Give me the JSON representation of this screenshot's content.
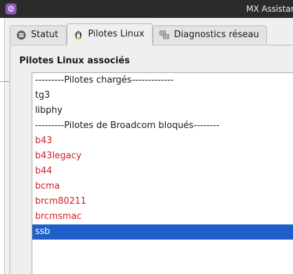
{
  "window": {
    "title": "MX Assistant",
    "icon": "gear-icon"
  },
  "tabs": [
    {
      "label": "Statut",
      "icon": "info-icon"
    },
    {
      "label": "Pilotes Linux",
      "icon": "tux-penguin-icon"
    },
    {
      "label": "Diagnostics réseau",
      "icon": "network-icon"
    }
  ],
  "active_tab": "Pilotes Linux",
  "main": {
    "section_title": "Pilotes Linux associés",
    "list": [
      {
        "text": "---------Pilotes chargés-------------",
        "kind": "header"
      },
      {
        "text": "tg3",
        "kind": "loaded"
      },
      {
        "text": "libphy",
        "kind": "loaded"
      },
      {
        "text": "---------Pilotes de Broadcom bloqués--------",
        "kind": "header"
      },
      {
        "text": "b43",
        "kind": "blocked"
      },
      {
        "text": "b43legacy",
        "kind": "blocked"
      },
      {
        "text": "b44",
        "kind": "blocked"
      },
      {
        "text": "bcma",
        "kind": "blocked"
      },
      {
        "text": "brcm80211",
        "kind": "blocked"
      },
      {
        "text": "brcmsmac",
        "kind": "blocked"
      },
      {
        "text": "ssb",
        "kind": "selected"
      }
    ]
  },
  "colors": {
    "blocked_text": "#d21e1e",
    "selection": "#1f5fc9",
    "titlebar": "#2b2b2b"
  }
}
